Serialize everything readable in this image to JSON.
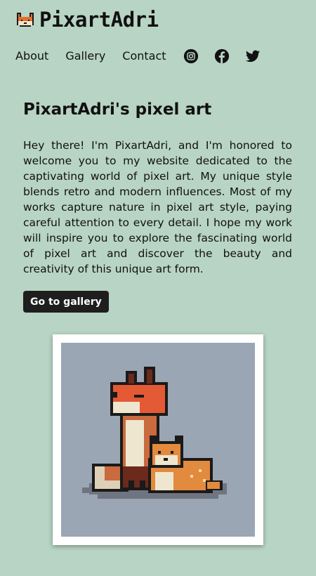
{
  "brand": {
    "name": "PixartAdri",
    "logo_icon": "fox-icon"
  },
  "nav": {
    "links": [
      "About",
      "Gallery",
      "Contact"
    ],
    "social": [
      "instagram-icon",
      "facebook-icon",
      "twitter-icon"
    ]
  },
  "main": {
    "title": "PixartAdri's pixel art",
    "intro": "Hey there! I'm PixartAdri, and I'm honored to welcome you to my website dedicated to the captivating world of pixel art. My unique style blends retro and modern influences. Most of my works capture nature in pixel art style, paying careful attention to every detail. I hope my work will inspire you to explore the fascinating world of pixel art and discover the beauty and creativity of this unique art form.",
    "cta_label": "Go to gallery"
  },
  "featured": {
    "image": "fox-pixel-art",
    "background": "#9ba6b4"
  },
  "colors": {
    "page_bg": "#b8d4c4",
    "button_bg": "#1e1e1e",
    "text": "#111111"
  }
}
